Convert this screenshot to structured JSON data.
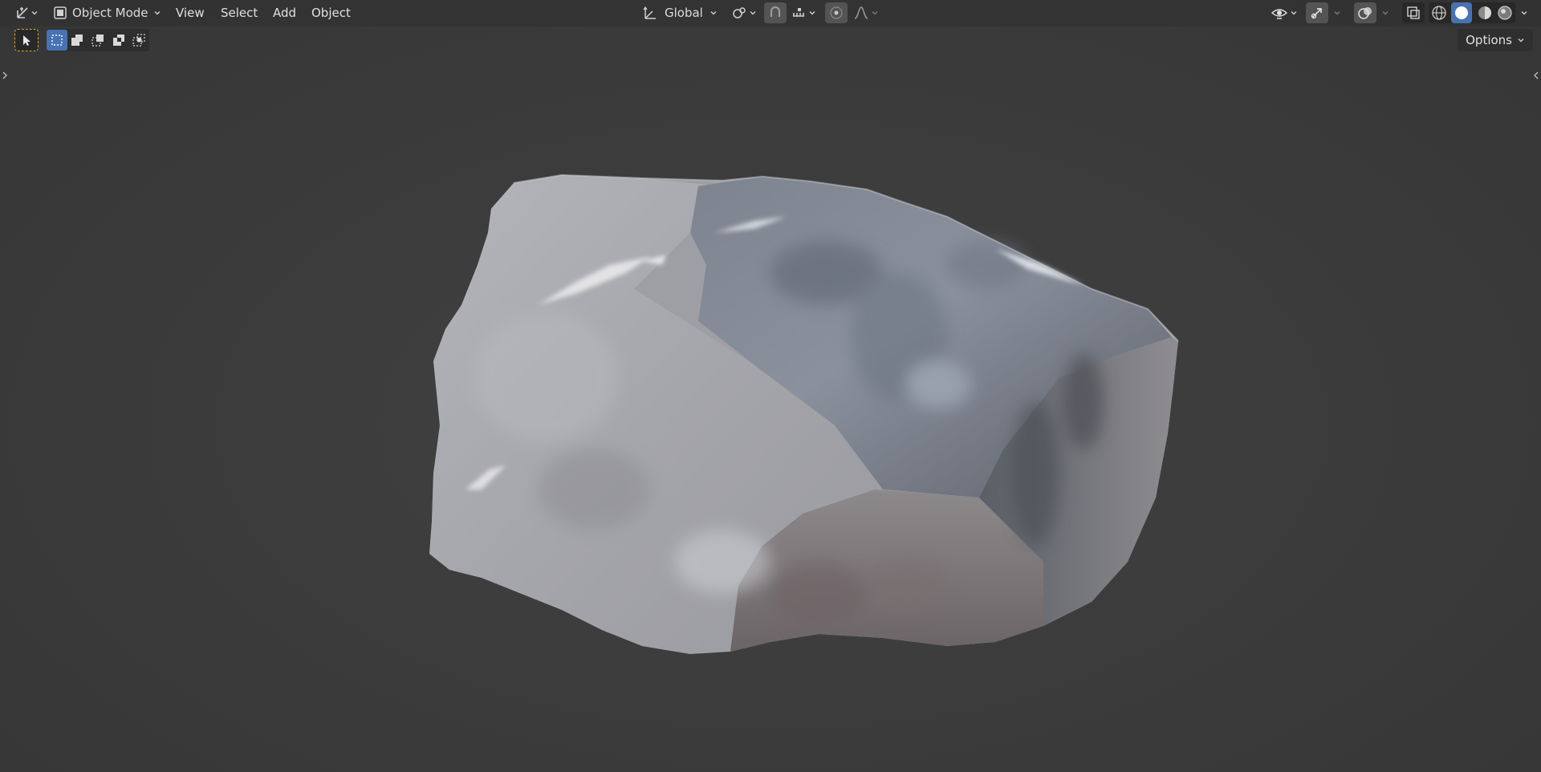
{
  "header": {
    "mode_label": "Object Mode",
    "menus": [
      "View",
      "Select",
      "Add",
      "Object"
    ],
    "transform_orientation": "Global",
    "icons": {
      "editor_type": "axis-gizmo-icon",
      "mode": "object-mode-icon",
      "orientation": "orientation-axis-icon",
      "pivot": "pivot-link-icon",
      "snap": "magnet-snap-icon",
      "snap_target": "snap-increment-icon",
      "proportional": "proportional-edit-icon",
      "falloff": "falloff-curve-icon",
      "visibility": "eye-visibility-icon",
      "gizmo": "gizmo-arrow-icon",
      "overlays": "overlays-icon",
      "xray": "xray-toggle-icon",
      "shading": [
        "wireframe-shading-icon",
        "solid-shading-icon",
        "material-shading-icon",
        "rendered-shading-icon"
      ]
    }
  },
  "toolbar": {
    "options_label": "Options",
    "select_modes": [
      "select-set-icon",
      "select-extend-icon",
      "select-subtract-icon",
      "select-difference-icon",
      "select-intersect-icon"
    ]
  },
  "colors": {
    "accent": "#4772b3",
    "active_tool_outline": "#e0a030",
    "background": "#3d3d3d"
  }
}
